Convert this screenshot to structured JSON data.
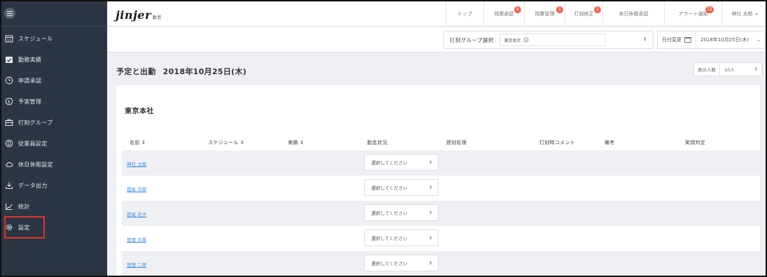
{
  "sidebar": {
    "items": [
      {
        "label": "スケジュール",
        "icon": "calendar-15-icon"
      },
      {
        "label": "勤務実績",
        "icon": "calendar-check-icon"
      },
      {
        "label": "申請承認",
        "icon": "clock-icon"
      },
      {
        "label": "予実管理",
        "icon": "dollar-circle-icon"
      },
      {
        "label": "打刻グループ",
        "icon": "briefcase-icon"
      },
      {
        "label": "従業員設定",
        "icon": "id-card-icon"
      },
      {
        "label": "休日休暇設定",
        "icon": "cloud-icon"
      },
      {
        "label": "データ出力",
        "icon": "download-icon"
      },
      {
        "label": "統計",
        "icon": "chart-line-icon"
      },
      {
        "label": "設定",
        "icon": "gear-icon"
      }
    ]
  },
  "header": {
    "logo": "jinjer",
    "logo_sub": "勤怠",
    "nav": [
      {
        "label": "トップ",
        "badge": ""
      },
      {
        "label": "残業承認",
        "badge": "4"
      },
      {
        "label": "残業管理",
        "badge": "1"
      },
      {
        "label": "打刻修正",
        "badge": "2"
      },
      {
        "label": "休日休暇承認",
        "badge": ""
      },
      {
        "label": "アラート通知",
        "badge": "72"
      }
    ],
    "user": "神社 太郎"
  },
  "subbar": {
    "group_label": "打刻グループ選択",
    "group_tag": "東京本社",
    "date_change_label": "日付変更",
    "date_value": "2018年10月25日(木)"
  },
  "page": {
    "title": "予定と出勤",
    "date": "2018年10月25日(木)",
    "display_count_label": "表示人数",
    "display_count_value": "10人"
  },
  "table": {
    "office": "東京本社",
    "headers": [
      "名前 ⇕",
      "スケジュール ⇕",
      "実績 ⇕",
      "勤怠状況",
      "遅刻処理",
      "打刻時コメント",
      "備考",
      "笑顔判定"
    ],
    "select_placeholder": "選択してください",
    "rows": [
      {
        "name": "神社 太郎"
      },
      {
        "name": "提尾 次郎"
      },
      {
        "name": "提尾 花子"
      },
      {
        "name": "管理 太郎"
      },
      {
        "name": "管理 二郎"
      }
    ]
  },
  "colors": {
    "sidebar_bg": "#2b3543",
    "highlight_border": "#e0332b",
    "badge": "#ef6650",
    "link": "#3a8ee6"
  }
}
